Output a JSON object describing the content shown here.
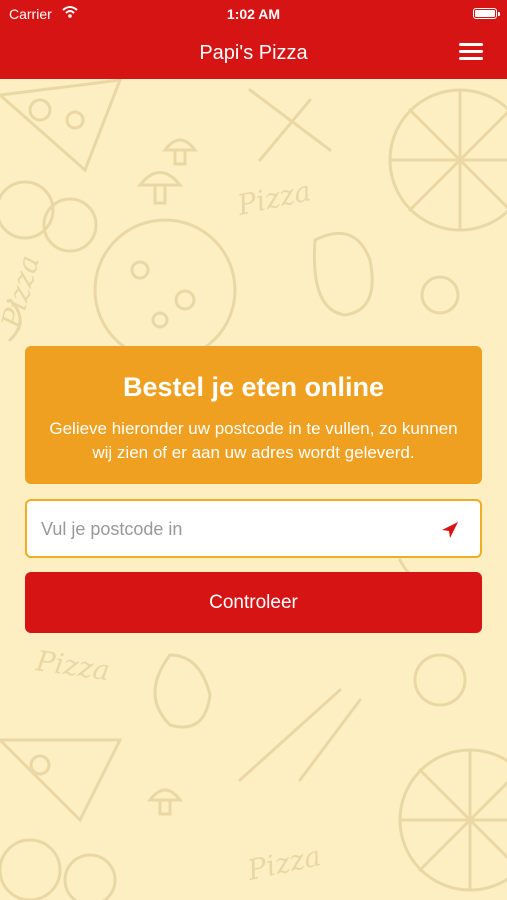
{
  "status_bar": {
    "carrier": "Carrier",
    "time": "1:02 AM"
  },
  "header": {
    "title": "Papi's Pizza"
  },
  "background": {
    "doodle_texts": [
      "Pizza",
      "Pizza",
      "Pizza",
      "Pizza"
    ]
  },
  "order_card": {
    "title": "Bestel je eten online",
    "description": "Gelieve hieronder uw postcode in te vullen, zo kunnen wij zien of er aan uw adres wordt geleverd."
  },
  "postcode_input": {
    "placeholder": "Vul je postcode in",
    "value": ""
  },
  "check_button": {
    "label": "Controleer"
  },
  "colors": {
    "brand_red": "#d61414",
    "card_orange": "#f0a020",
    "background": "#fdefc2"
  }
}
